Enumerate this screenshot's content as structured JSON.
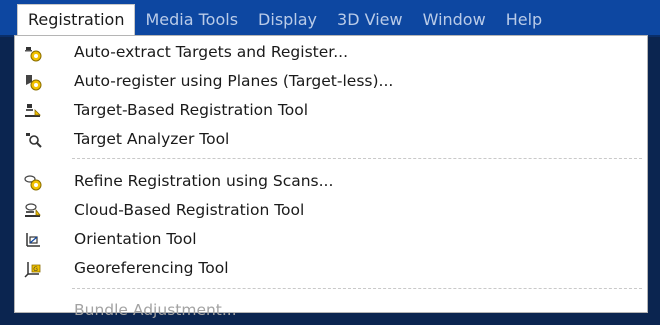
{
  "menubar": {
    "items": [
      {
        "label": "Registration",
        "active": true
      },
      {
        "label": "Media Tools"
      },
      {
        "label": "Display"
      },
      {
        "label": "3D View"
      },
      {
        "label": "Window"
      },
      {
        "label": "Help"
      }
    ]
  },
  "dropdown": {
    "items": [
      {
        "label": "Auto-extract Targets and Register...",
        "icon": "auto-extract-targets-icon"
      },
      {
        "label": "Auto-register using Planes (Target-less)...",
        "icon": "auto-register-planes-icon"
      },
      {
        "label": "Target-Based Registration Tool",
        "icon": "target-registration-icon"
      },
      {
        "label": "Target Analyzer Tool",
        "icon": "target-analyzer-icon"
      },
      {
        "label": "Refine Registration using Scans...",
        "icon": "refine-registration-icon"
      },
      {
        "label": "Cloud-Based Registration Tool",
        "icon": "cloud-registration-icon"
      },
      {
        "label": "Orientation Tool",
        "icon": "orientation-icon"
      },
      {
        "label": "Georeferencing Tool",
        "icon": "georeferencing-icon"
      },
      {
        "label": "Bundle Adjustment...",
        "disabled": true
      }
    ]
  },
  "colors": {
    "menubar_bg": "#0d47a1",
    "menubar_text": "#b9cbe8",
    "menu_bg": "#ffffff",
    "disabled_text": "#a3a3a3",
    "icon_yellow": "#f2c200"
  }
}
